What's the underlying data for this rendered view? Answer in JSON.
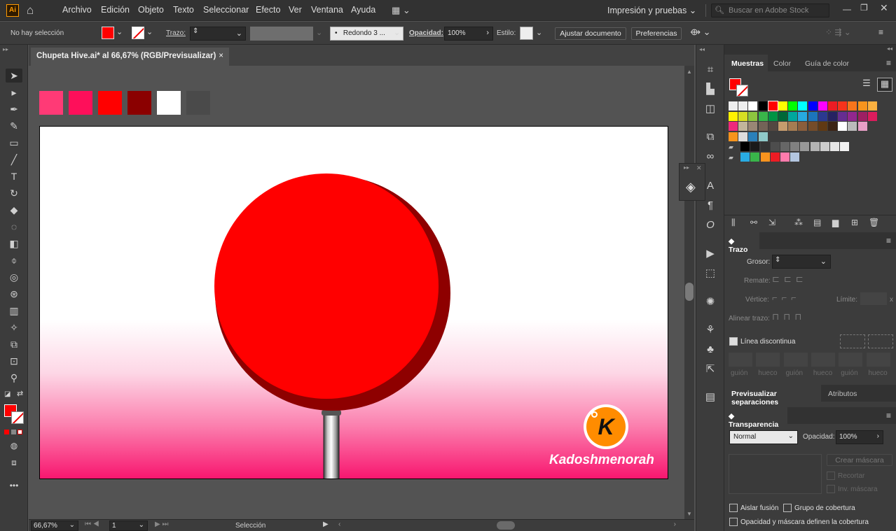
{
  "app": {
    "logo": "Ai"
  },
  "menu": [
    "Archivo",
    "Edición",
    "Objeto",
    "Texto",
    "Seleccionar",
    "Efecto",
    "Ver",
    "Ventana",
    "Ayuda"
  ],
  "workspace": "Impresión y pruebas",
  "search_placeholder": "Buscar en Adobe Stock",
  "control": {
    "selection": "No hay selección",
    "stroke_label": "Trazo:",
    "brush": "Redondo 3 ...",
    "opacity_label": "Opacidad:",
    "opacity_value": "100%",
    "style_label": "Estilo:",
    "adjust_button": "Ajustar documento",
    "prefs_button": "Preferencias"
  },
  "doc_tab": "Chupeta Hive.ai* al 66,67% (RGB/Previsualizar)",
  "doc_tab_close": "×",
  "swatch_colors": [
    "#ff3a76",
    "#fe0f5a",
    "#ff0000",
    "#8b0000",
    "#ffffff",
    "#4a4a4a"
  ],
  "watermark": {
    "letter": "K",
    "text": "Kadoshmenorah"
  },
  "status": {
    "zoom": "66,67%",
    "page": "1",
    "tool": "Selección"
  },
  "panels": {
    "swatches_tabs": [
      "Muestras",
      "Color",
      "Guía de color"
    ],
    "trazo": {
      "title": "Trazo",
      "grosor": "Grosor:",
      "remate": "Remate:",
      "vertice": "Vértice:",
      "limite": "Límite:",
      "limite_x": "x",
      "alinear": "Alinear trazo:",
      "dashed": "Línea discontinua",
      "dash_labels": [
        "guión",
        "hueco",
        "guión",
        "hueco",
        "guión",
        "hueco"
      ]
    },
    "sep_tabs": [
      "Previsualizar separaciones",
      "Atributos"
    ],
    "transparencia": {
      "title": "Transparencia",
      "mode": "Normal",
      "opacity_label": "Opacidad:",
      "opacity_value": "100%",
      "mask_button": "Crear máscara",
      "recortar": "Recortar",
      "invertir": "Inv. máscara",
      "aislar": "Aislar fusión",
      "grupo": "Grupo de cobertura",
      "opmask": "Opacidad y máscara definen la cobertura"
    }
  },
  "accent": {
    "fill": "#ff0000",
    "orange": "#ff8c00"
  }
}
